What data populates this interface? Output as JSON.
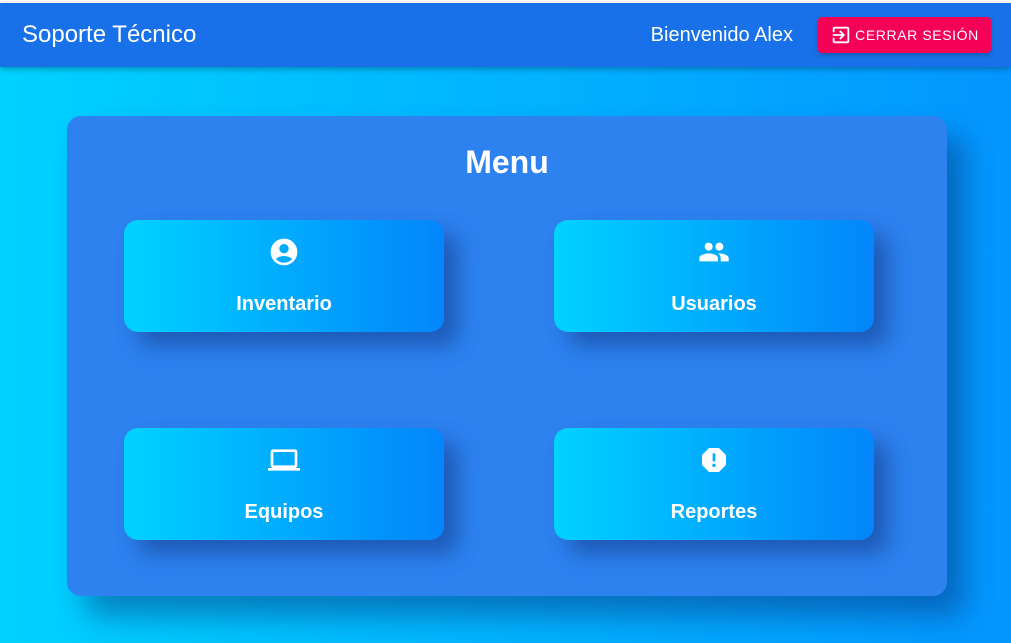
{
  "appbar": {
    "title": "Soporte Técnico",
    "welcome": "Bienvenido Alex",
    "logout_label": "CERRAR SESIÓN",
    "logout_icon": "exit-to-app-icon",
    "background_color": "#1871e8",
    "logout_color": "#f50057"
  },
  "menu": {
    "title": "Menu",
    "items": [
      {
        "label": "Inventario",
        "icon": "account-circle-icon"
      },
      {
        "label": "Usuarios",
        "icon": "people-icon"
      },
      {
        "label": "Equipos",
        "icon": "laptop-icon"
      },
      {
        "label": "Reportes",
        "icon": "report-icon"
      }
    ],
    "panel_color": "#2d82f0",
    "tile_gradient": [
      "#00d2ff",
      "#0385fb"
    ]
  },
  "page": {
    "background_gradient": [
      "#00d2ff",
      "#0396ff"
    ]
  }
}
